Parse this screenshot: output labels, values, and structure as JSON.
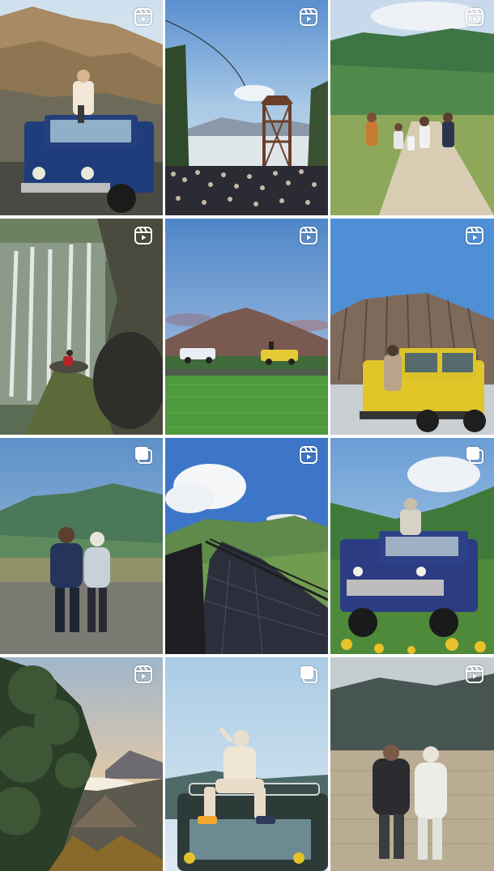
{
  "screen": "profile-post-grid",
  "tiles": [
    {
      "row": 1,
      "col": 1,
      "type": "reel",
      "badge_icon": "reels-icon",
      "subject": "woman-sitting-on-blue-jeep-hillside"
    },
    {
      "row": 1,
      "col": 2,
      "type": "reel",
      "badge_icon": "reels-icon",
      "subject": "crowd-at-watchtower-viewpoint"
    },
    {
      "row": 1,
      "col": 3,
      "type": "reel",
      "badge_icon": "reels-icon",
      "subject": "family-walking-on-savanna-path"
    },
    {
      "row": 2,
      "col": 1,
      "type": "reel",
      "badge_icon": "reels-icon",
      "subject": "waterfall-with-person-on-rock"
    },
    {
      "row": 2,
      "col": 2,
      "type": "reel",
      "badge_icon": "reels-icon",
      "subject": "volcano-with-jeeps-and-fields"
    },
    {
      "row": 2,
      "col": 3,
      "type": "reel",
      "badge_icon": "reels-icon",
      "subject": "yellow-jeep-under-ridged-mountain"
    },
    {
      "row": 3,
      "col": 1,
      "type": "carousel",
      "badge_icon": "multiple-photos-icon",
      "subject": "couple-walking-in-savanna"
    },
    {
      "row": 3,
      "col": 2,
      "type": "reel",
      "badge_icon": "reels-icon",
      "subject": "curved-boardwalk-in-hills"
    },
    {
      "row": 3,
      "col": 3,
      "type": "carousel",
      "badge_icon": "multiple-photos-icon",
      "subject": "woman-on-blue-jeep-flowers"
    },
    {
      "row": 4,
      "col": 1,
      "type": "reel",
      "badge_icon": "reels-icon",
      "subject": "pine-tree-over-misty-caldera"
    },
    {
      "row": 4,
      "col": 2,
      "type": "carousel",
      "badge_icon": "multiple-photos-icon",
      "subject": "woman-posing-on-jeep-roof"
    },
    {
      "row": 4,
      "col": 3,
      "type": "reel",
      "badge_icon": "reels-icon",
      "subject": "couple-standing-in-grass-field"
    }
  ]
}
